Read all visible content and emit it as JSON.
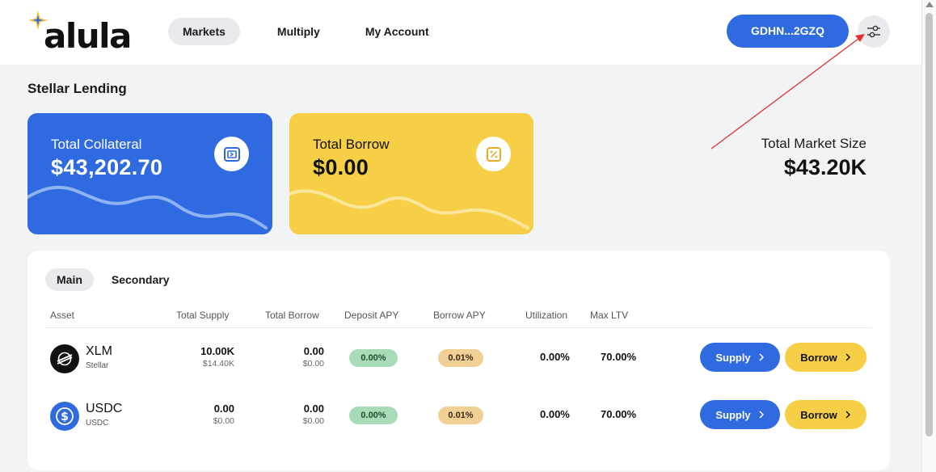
{
  "brand": {
    "name": "alula"
  },
  "nav": {
    "items": [
      "Markets",
      "Multiply",
      "My Account"
    ]
  },
  "wallet": {
    "label": "GDHN...2GZQ"
  },
  "page": {
    "title": "Stellar Lending"
  },
  "cards": {
    "collateral": {
      "label": "Total Collateral",
      "value": "$43,202.70"
    },
    "borrow": {
      "label": "Total Borrow",
      "value": "$0.00"
    }
  },
  "market_size": {
    "label": "Total Market Size",
    "value": "$43.20K"
  },
  "tabs": [
    "Main",
    "Secondary"
  ],
  "table": {
    "headers": [
      "Asset",
      "Total Supply",
      "Total Borrow",
      "Deposit APY",
      "Borrow APY",
      "Utilization",
      "Max LTV"
    ],
    "rows": [
      {
        "symbol": "XLM",
        "name": "Stellar",
        "supply": "10.00K",
        "supply_usd": "$14.40K",
        "borrow": "0.00",
        "borrow_usd": "$0.00",
        "deposit_apy": "0.00%",
        "borrow_apy": "0.01%",
        "utilization": "0.00%",
        "max_ltv": "70.00%",
        "supply_btn": "Supply",
        "borrow_btn": "Borrow"
      },
      {
        "symbol": "USDC",
        "name": "USDC",
        "supply": "0.00",
        "supply_usd": "$0.00",
        "borrow": "0.00",
        "borrow_usd": "$0.00",
        "deposit_apy": "0.00%",
        "borrow_apy": "0.01%",
        "utilization": "0.00%",
        "max_ltv": "70.00%",
        "supply_btn": "Supply",
        "borrow_btn": "Borrow"
      }
    ]
  },
  "colors": {
    "accent_blue": "#2f6ae0",
    "accent_yellow": "#f6cf46",
    "annotation_red": "#e53030"
  }
}
